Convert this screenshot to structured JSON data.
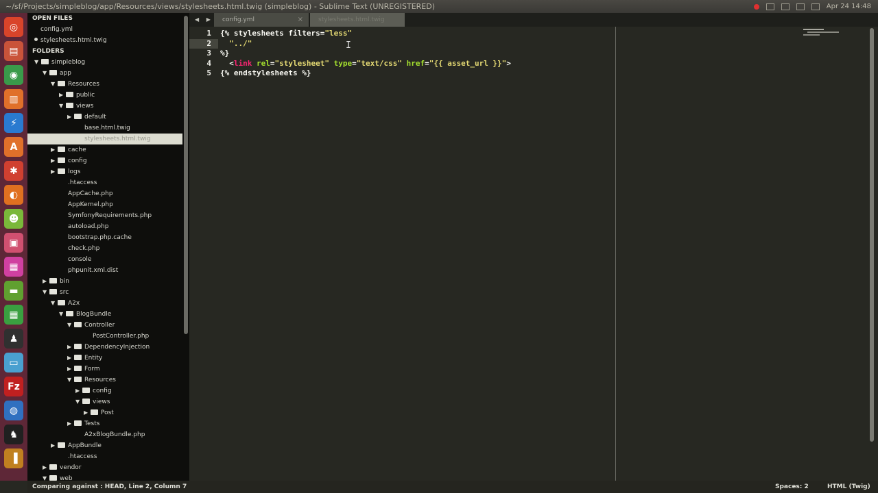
{
  "window": {
    "title": "~/sf/Projects/simpleblog/app/Resources/views/stylesheets.html.twig (simpleblog) - Sublime Text (UNREGISTERED)",
    "clock": "Apr 24 14:48"
  },
  "launcher": [
    {
      "name": "ubuntu-dash-icon",
      "glyph": "◎",
      "color": "#d9442a"
    },
    {
      "name": "files-icon",
      "glyph": "▤",
      "color": "#c9533a"
    },
    {
      "name": "chrome-icon",
      "glyph": "◉",
      "color": "#3a9a4a"
    },
    {
      "name": "archive-icon",
      "glyph": "▥",
      "color": "#e0702a"
    },
    {
      "name": "thunderbolt-icon",
      "glyph": "⚡",
      "color": "#2a7ad0"
    },
    {
      "name": "software-center-icon",
      "glyph": "A",
      "color": "#e0702a"
    },
    {
      "name": "settings-icon",
      "glyph": "✱",
      "color": "#d04030"
    },
    {
      "name": "firefox-icon",
      "glyph": "◐",
      "color": "#e07020"
    },
    {
      "name": "android-icon",
      "glyph": "☻",
      "color": "#7ab83a"
    },
    {
      "name": "vm-icon",
      "glyph": "▣",
      "color": "#d05070"
    },
    {
      "name": "calendar-icon",
      "glyph": "▦",
      "color": "#d040a0"
    },
    {
      "name": "terminal-icon",
      "glyph": "▬",
      "color": "#60a030"
    },
    {
      "name": "spreadsheet-icon",
      "glyph": "▦",
      "color": "#3aa040"
    },
    {
      "name": "tux-icon",
      "glyph": "♟",
      "color": "#303030"
    },
    {
      "name": "notes-icon",
      "glyph": "▭",
      "color": "#4aa0d0"
    },
    {
      "name": "filezilla-icon",
      "glyph": "Fz",
      "color": "#c02020"
    },
    {
      "name": "browser-icon",
      "glyph": "◍",
      "color": "#3070c0"
    },
    {
      "name": "penguin-icon",
      "glyph": "♞",
      "color": "#202020"
    },
    {
      "name": "books-icon",
      "glyph": "▐",
      "color": "#c08020"
    }
  ],
  "sidebar": {
    "open_files_header": "OPEN FILES",
    "open_files": [
      {
        "label": "config.yml",
        "active": false
      },
      {
        "label": "stylesheets.html.twig",
        "active": true
      }
    ],
    "folders_header": "FOLDERS",
    "tree": [
      {
        "label": "simpleblog",
        "depth": 0,
        "type": "folder",
        "open": true
      },
      {
        "label": "app",
        "depth": 1,
        "type": "folder",
        "open": true
      },
      {
        "label": "Resources",
        "depth": 2,
        "type": "folder",
        "open": true
      },
      {
        "label": "public",
        "depth": 3,
        "type": "folder",
        "open": false
      },
      {
        "label": "views",
        "depth": 3,
        "type": "folder",
        "open": true
      },
      {
        "label": "default",
        "depth": 4,
        "type": "folder",
        "open": false
      },
      {
        "label": "base.html.twig",
        "depth": 4,
        "type": "file"
      },
      {
        "label": "stylesheets.html.twig",
        "depth": 4,
        "type": "file",
        "selected": true
      },
      {
        "label": "cache",
        "depth": 2,
        "type": "folder",
        "open": false
      },
      {
        "label": "config",
        "depth": 2,
        "type": "folder",
        "open": false
      },
      {
        "label": "logs",
        "depth": 2,
        "type": "folder",
        "open": false
      },
      {
        "label": ".htaccess",
        "depth": 2,
        "type": "file"
      },
      {
        "label": "AppCache.php",
        "depth": 2,
        "type": "file"
      },
      {
        "label": "AppKernel.php",
        "depth": 2,
        "type": "file"
      },
      {
        "label": "SymfonyRequirements.php",
        "depth": 2,
        "type": "file"
      },
      {
        "label": "autoload.php",
        "depth": 2,
        "type": "file"
      },
      {
        "label": "bootstrap.php.cache",
        "depth": 2,
        "type": "file"
      },
      {
        "label": "check.php",
        "depth": 2,
        "type": "file"
      },
      {
        "label": "console",
        "depth": 2,
        "type": "file"
      },
      {
        "label": "phpunit.xml.dist",
        "depth": 2,
        "type": "file"
      },
      {
        "label": "bin",
        "depth": 1,
        "type": "folder",
        "open": false
      },
      {
        "label": "src",
        "depth": 1,
        "type": "folder",
        "open": true
      },
      {
        "label": "A2x",
        "depth": 2,
        "type": "folder",
        "open": true
      },
      {
        "label": "BlogBundle",
        "depth": 3,
        "type": "folder",
        "open": true
      },
      {
        "label": "Controller",
        "depth": 4,
        "type": "folder",
        "open": true
      },
      {
        "label": "PostController.php",
        "depth": 5,
        "type": "file"
      },
      {
        "label": "DependencyInjection",
        "depth": 4,
        "type": "folder",
        "open": false
      },
      {
        "label": "Entity",
        "depth": 4,
        "type": "folder",
        "open": false
      },
      {
        "label": "Form",
        "depth": 4,
        "type": "folder",
        "open": false
      },
      {
        "label": "Resources",
        "depth": 4,
        "type": "folder",
        "open": true
      },
      {
        "label": "config",
        "depth": 5,
        "type": "folder",
        "open": false
      },
      {
        "label": "views",
        "depth": 5,
        "type": "folder",
        "open": true
      },
      {
        "label": "Post",
        "depth": 6,
        "type": "folder",
        "open": false
      },
      {
        "label": "Tests",
        "depth": 4,
        "type": "folder",
        "open": false
      },
      {
        "label": "A2xBlogBundle.php",
        "depth": 4,
        "type": "file"
      },
      {
        "label": "AppBundle",
        "depth": 2,
        "type": "folder",
        "open": false
      },
      {
        "label": ".htaccess",
        "depth": 2,
        "type": "file"
      },
      {
        "label": "vendor",
        "depth": 1,
        "type": "folder",
        "open": false
      },
      {
        "label": "web",
        "depth": 1,
        "type": "folder",
        "open": true
      }
    ]
  },
  "tabs": [
    {
      "label": "config.yml",
      "close": "×"
    },
    {
      "label": "stylesheets.html.twig",
      "close": "×"
    }
  ],
  "editor": {
    "line_numbers": [
      "1",
      "2",
      "3",
      "4",
      "5"
    ],
    "current_line": 2,
    "lines": [
      [
        {
          "t": "{% stylesheets ",
          "c": "c-punc"
        },
        {
          "t": "filters",
          "c": "c-kw"
        },
        {
          "t": "=",
          "c": "c-punc"
        },
        {
          "t": "\"less\"",
          "c": "c-str"
        }
      ],
      [
        {
          "t": "  \"../",
          "c": "c-str"
        },
        {
          "t": "\"",
          "c": "c-str"
        }
      ],
      [
        {
          "t": "%}",
          "c": "c-punc"
        }
      ],
      [
        {
          "t": "  <",
          "c": "c-punc"
        },
        {
          "t": "link",
          "c": "c-tag"
        },
        {
          "t": " rel",
          "c": "c-attr"
        },
        {
          "t": "=",
          "c": "c-punc"
        },
        {
          "t": "\"stylesheet\"",
          "c": "c-str"
        },
        {
          "t": " type",
          "c": "c-attr"
        },
        {
          "t": "=",
          "c": "c-punc"
        },
        {
          "t": "\"text/css\"",
          "c": "c-str"
        },
        {
          "t": " href",
          "c": "c-attr"
        },
        {
          "t": "=",
          "c": "c-punc"
        },
        {
          "t": "\"{{ asset_url }}\"",
          "c": "c-str"
        },
        {
          "t": ">",
          "c": "c-punc"
        }
      ],
      [
        {
          "t": "{% endstylesheets %}",
          "c": "c-punc"
        }
      ]
    ]
  },
  "statusbar": {
    "left": "Comparing against : HEAD, Line 2, Column 7",
    "spaces": "Spaces: 2",
    "syntax": "HTML (Twig)"
  }
}
